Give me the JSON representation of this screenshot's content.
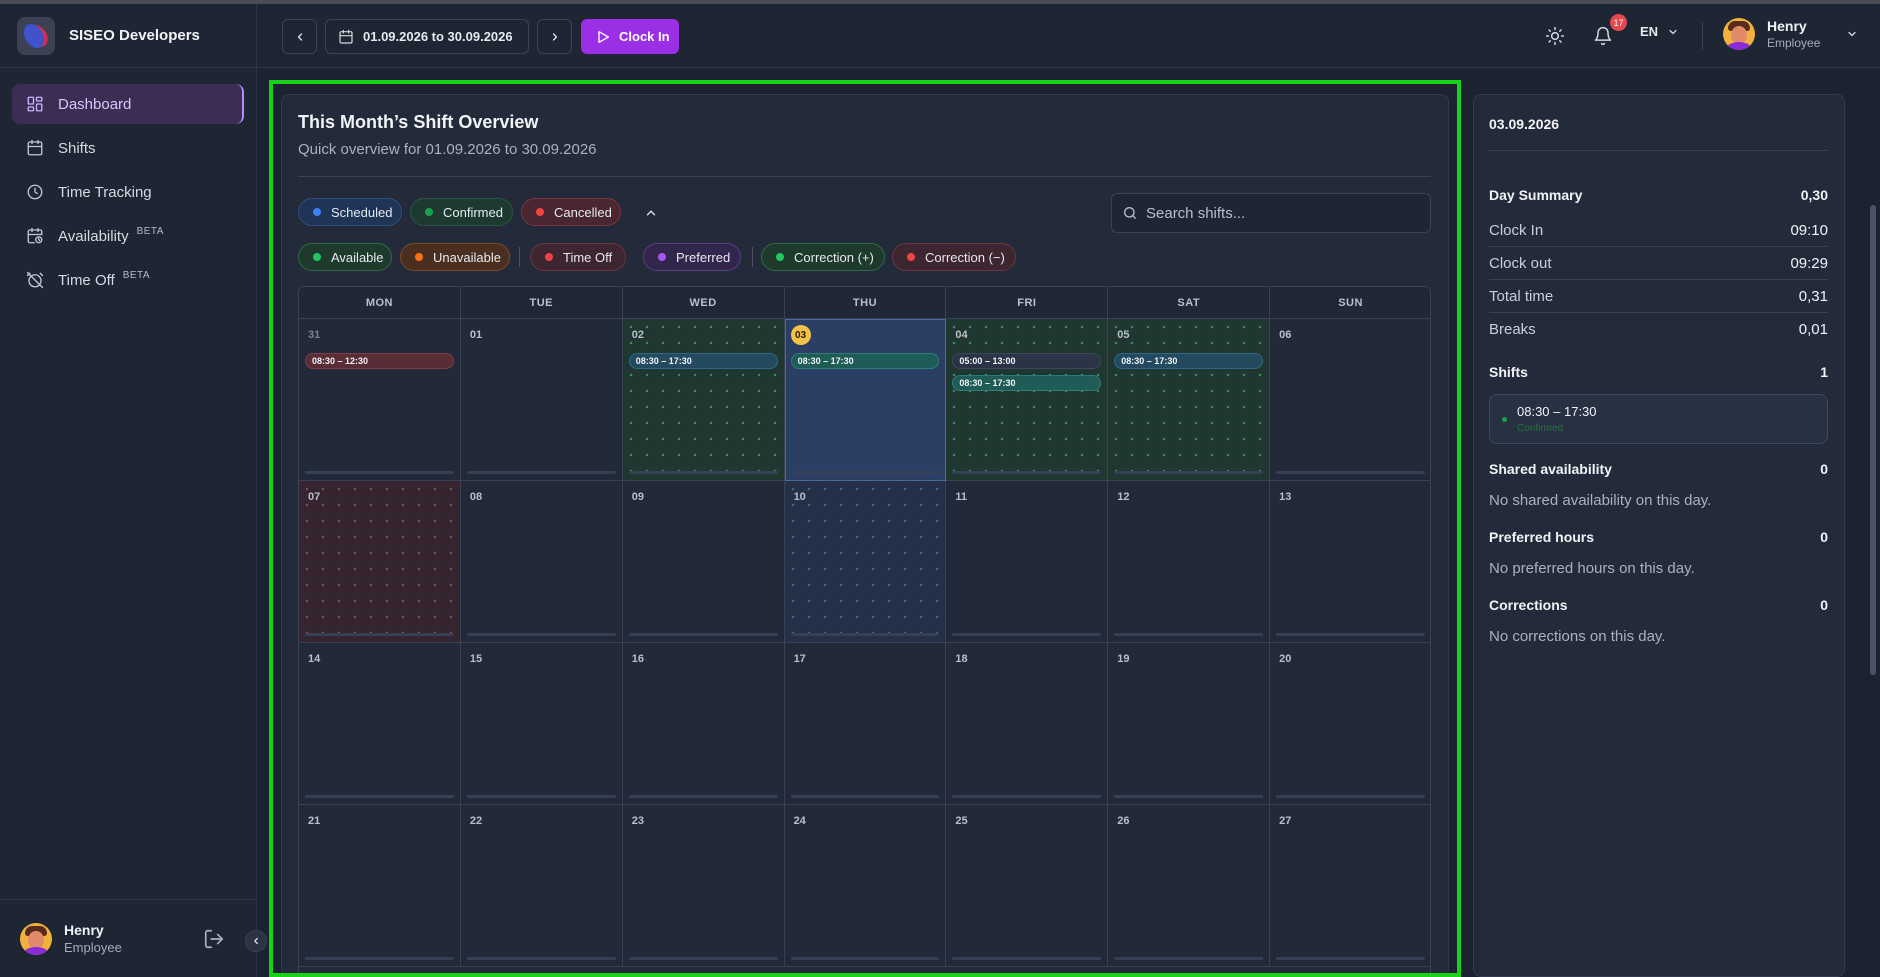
{
  "brand": {
    "name": "SISEO Developers"
  },
  "sidebar": {
    "items": [
      {
        "label": "Dashboard",
        "icon": "dashboard-icon",
        "active": true,
        "beta": ""
      },
      {
        "label": "Shifts",
        "icon": "calendar-icon",
        "active": false,
        "beta": ""
      },
      {
        "label": "Time Tracking",
        "icon": "clock-icon",
        "active": false,
        "beta": ""
      },
      {
        "label": "Availability",
        "icon": "calendar-clock-icon",
        "active": false,
        "beta": "BETA"
      },
      {
        "label": "Time Off",
        "icon": "alarm-off-icon",
        "active": false,
        "beta": "BETA"
      }
    ]
  },
  "user": {
    "name": "Henry",
    "role": "Employee"
  },
  "topbar": {
    "range_label": "01.09.2026 to 30.09.2026",
    "clock_in_label": "Clock In",
    "notifications_count": "17",
    "language": "EN"
  },
  "overview": {
    "title": "This Month’s Shift Overview",
    "subtitle": "Quick overview for 01.09.2026 to 30.09.2026",
    "search_placeholder": "Search shifts...",
    "status_filters": [
      {
        "label": "Scheduled",
        "dot": "#3b82f6",
        "bg": "#1f3457",
        "border": "#2e4f82"
      },
      {
        "label": "Confirmed",
        "dot": "#16a34a",
        "bg": "#1e3a30",
        "border": "#2a5443"
      },
      {
        "label": "Cancelled",
        "dot": "#ef4444",
        "bg": "#4a2630",
        "border": "#7a3440"
      }
    ],
    "type_filters": [
      {
        "label": "Available",
        "dot": "#22c55e",
        "bg": "#1e3a2c",
        "border": "#2d6a46"
      },
      {
        "label": "Unavailable",
        "dot": "#f97316",
        "bg": "#4a2f20",
        "border": "#7a4a2a"
      },
      {
        "label": "Time Off",
        "dot": "#ef4444",
        "bg": "#3d2630",
        "border": "#6a3440"
      },
      {
        "label": "Preferred",
        "dot": "#a855f7",
        "bg": "#33264d",
        "border": "#5a3e82"
      },
      {
        "label": "Correction (+)",
        "dot": "#22c55e",
        "bg": "#1e3a2c",
        "border": "#2d6a46"
      },
      {
        "label": "Correction (−)",
        "dot": "#ef4444",
        "bg": "#3d2630",
        "border": "#6a3440"
      }
    ]
  },
  "calendar": {
    "weekdays": [
      "MON",
      "TUE",
      "WED",
      "THU",
      "FRI",
      "SAT",
      "SUN"
    ],
    "weeks": [
      [
        {
          "day": "31",
          "muted": true,
          "bg": "",
          "shifts": [
            {
              "time": "08:30 – 12:30",
              "style": "red"
            }
          ]
        },
        {
          "day": "01",
          "bg": "",
          "shifts": []
        },
        {
          "day": "02",
          "bg": "green",
          "shifts": [
            {
              "time": "08:30 – 17:30",
              "style": "blue"
            }
          ]
        },
        {
          "day": "03",
          "today": true,
          "bg": "sel",
          "shifts": [
            {
              "time": "08:30 – 17:30",
              "style": "teal"
            }
          ]
        },
        {
          "day": "04",
          "bg": "green",
          "shifts": [
            {
              "time": "05:00 – 13:00",
              "style": "dark"
            },
            {
              "time": "08:30 – 17:30",
              "style": "teal"
            }
          ]
        },
        {
          "day": "05",
          "bg": "green",
          "shifts": [
            {
              "time": "08:30 – 17:30",
              "style": "blue"
            }
          ]
        },
        {
          "day": "06",
          "bg": "",
          "shifts": []
        }
      ],
      [
        {
          "day": "07",
          "bg": "red",
          "shifts": []
        },
        {
          "day": "08",
          "bg": "",
          "shifts": []
        },
        {
          "day": "09",
          "bg": "",
          "shifts": []
        },
        {
          "day": "10",
          "bg": "blue",
          "shifts": []
        },
        {
          "day": "11",
          "bg": "",
          "shifts": []
        },
        {
          "day": "12",
          "bg": "",
          "shifts": []
        },
        {
          "day": "13",
          "bg": "",
          "shifts": []
        }
      ],
      [
        {
          "day": "14",
          "bg": "",
          "shifts": []
        },
        {
          "day": "15",
          "bg": "",
          "shifts": []
        },
        {
          "day": "16",
          "bg": "",
          "shifts": []
        },
        {
          "day": "17",
          "bg": "",
          "shifts": []
        },
        {
          "day": "18",
          "bg": "",
          "shifts": []
        },
        {
          "day": "19",
          "bg": "",
          "shifts": []
        },
        {
          "day": "20",
          "bg": "",
          "shifts": []
        }
      ],
      [
        {
          "day": "21",
          "bg": "",
          "shifts": []
        },
        {
          "day": "22",
          "bg": "",
          "shifts": []
        },
        {
          "day": "23",
          "bg": "",
          "shifts": []
        },
        {
          "day": "24",
          "bg": "",
          "shifts": []
        },
        {
          "day": "25",
          "bg": "",
          "shifts": []
        },
        {
          "day": "26",
          "bg": "",
          "shifts": []
        },
        {
          "day": "27",
          "bg": "",
          "shifts": []
        }
      ]
    ]
  },
  "day_panel": {
    "date": "03.09.2026",
    "summary_label": "Day Summary",
    "summary_value": "0,30",
    "rows": [
      {
        "label": "Clock In",
        "value": "09:10"
      },
      {
        "label": "Clock out",
        "value": "09:29"
      },
      {
        "label": "Total time",
        "value": "0,31"
      },
      {
        "label": "Breaks",
        "value": "0,01"
      }
    ],
    "shifts_label": "Shifts",
    "shifts_count": "1",
    "shift_time": "08:30 – 17:30",
    "shift_status": "Confirmed",
    "shared_label": "Shared availability",
    "shared_count": "0",
    "shared_note": "No shared availability on this day.",
    "preferred_label": "Preferred hours",
    "preferred_count": "0",
    "preferred_note": "No preferred hours on this day.",
    "corrections_label": "Corrections",
    "corrections_count": "0",
    "corrections_note": "No corrections on this day."
  }
}
